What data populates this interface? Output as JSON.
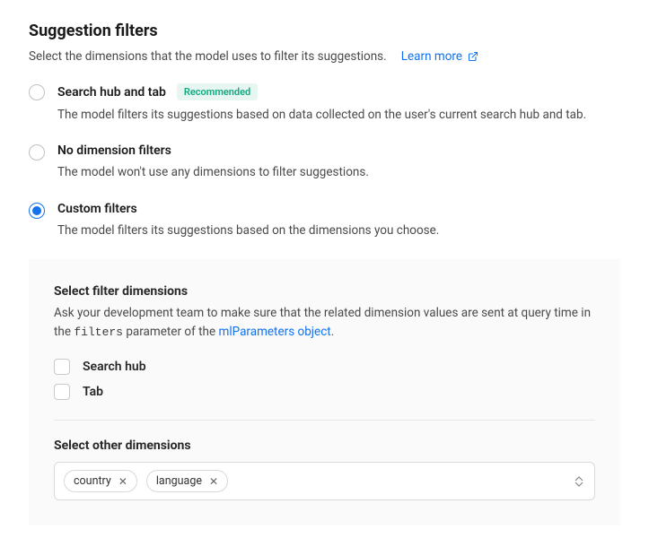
{
  "heading": "Suggestion filters",
  "subtitle": "Select the dimensions that the model uses to filter its suggestions.",
  "learnMore": "Learn more",
  "options": [
    {
      "label": "Search hub and tab",
      "badge": "Recommended",
      "desc": "The model filters its suggestions based on data collected on the user's current search hub and tab."
    },
    {
      "label": "No dimension filters",
      "desc": "The model won't use any dimensions to filter suggestions."
    },
    {
      "label": "Custom filters",
      "desc": "The model filters its suggestions based on the dimensions you choose."
    }
  ],
  "panel": {
    "heading1": "Select filter dimensions",
    "desc1_a": "Ask your development team to make sure that the related dimension values are sent at query time in the ",
    "desc1_code": "filters",
    "desc1_b": " parameter of the ",
    "desc1_link": "mlParameters object",
    "desc1_c": ".",
    "checks": [
      "Search hub",
      "Tab"
    ],
    "heading2": "Select other dimensions",
    "tags": [
      "country",
      "language"
    ]
  }
}
